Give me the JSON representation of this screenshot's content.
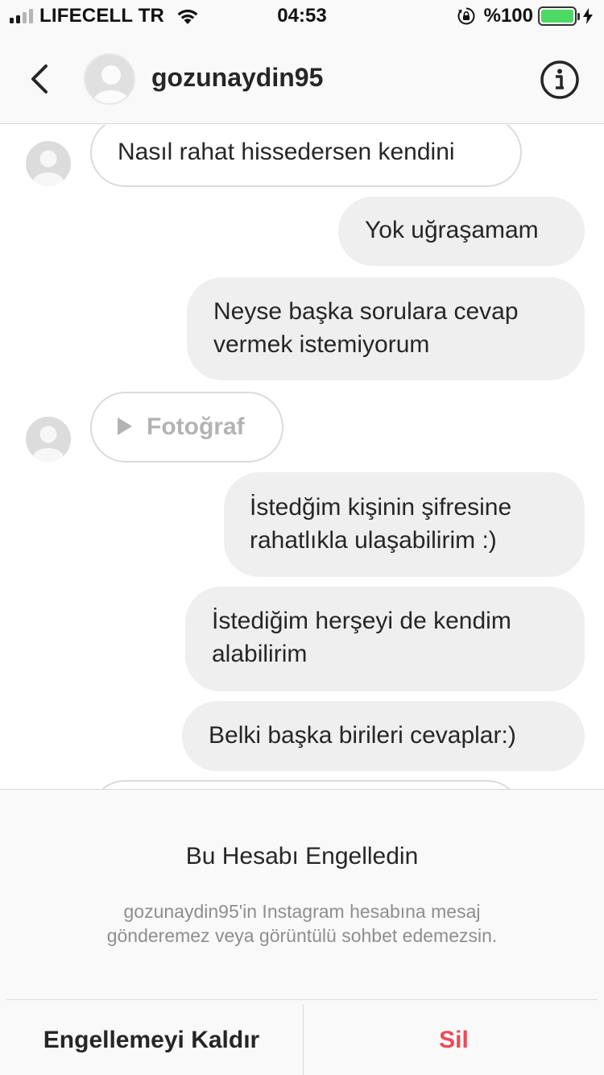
{
  "status_bar": {
    "carrier": "LIFECELL TR",
    "time": "04:53",
    "battery_percent": "%100",
    "signal_bars": 4,
    "signal_bars_active": 2,
    "battery_level": 1.0,
    "battery_color": "#4cd964",
    "icons": [
      "signal-icon",
      "wifi-icon",
      "orientation-lock-icon",
      "battery-icon",
      "charging-bolt-icon"
    ]
  },
  "header": {
    "back_icon": "chevron-left-icon",
    "username": "gozunaydin95",
    "info_icon": "info-circle-icon"
  },
  "messages": [
    {
      "direction": "incoming",
      "text": "Nasıl rahat hissedersen kendini",
      "has_avatar": true
    },
    {
      "direction": "outgoing",
      "text": "Yok uğraşamam"
    },
    {
      "direction": "outgoing",
      "lines": [
        "Neyse başka sorulara cevap",
        "vermek istemiyorum"
      ]
    },
    {
      "direction": "incoming",
      "type": "photo",
      "text": "Fotoğraf",
      "icon": "play-icon",
      "has_avatar": true
    },
    {
      "direction": "outgoing",
      "lines": [
        "İstedğim kişinin şifresine",
        "rahatlıkla ulaşabilirim :)"
      ]
    },
    {
      "direction": "outgoing",
      "lines": [
        "İstediğim herşeyi de kendim",
        "alabilirim"
      ]
    },
    {
      "direction": "outgoing",
      "text": "Belki başka birileri cevaplar:)"
    }
  ],
  "blocked_panel": {
    "title": "Bu Hesabı Engelledin",
    "description_lines": [
      "gozunaydin95'in Instagram hesabına mesaj",
      "gönderemez veya görüntülü sohbet edemezsin."
    ],
    "unblock_label": "Engellemeyi Kaldır",
    "delete_label": "Sil",
    "delete_color": "#ed4956"
  }
}
